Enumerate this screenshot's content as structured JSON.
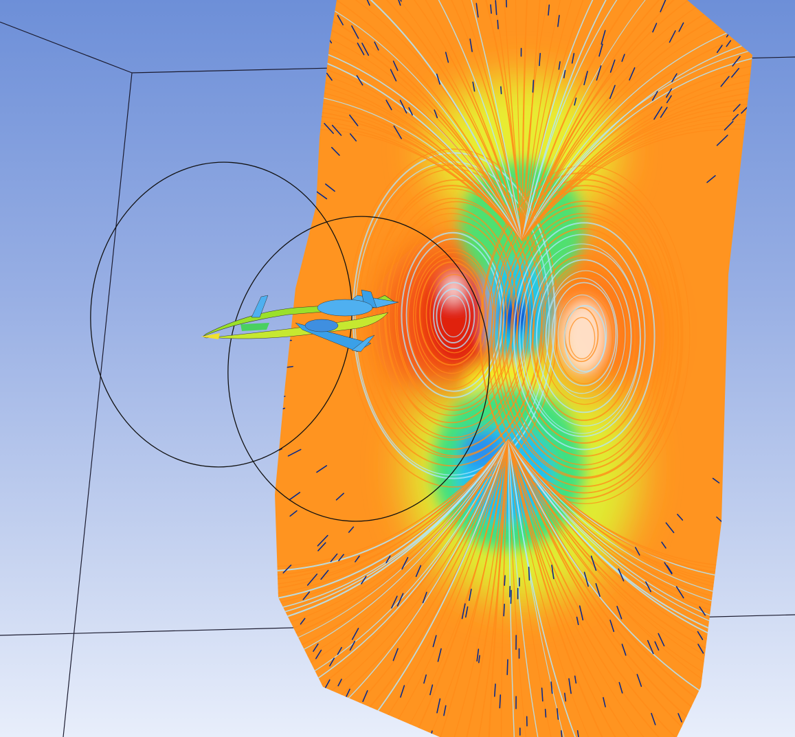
{
  "viewport": {
    "kind": "3d-cfd-visualization",
    "background_top": "#6d8fd8",
    "background_bottom": "#e8eefb"
  },
  "scene": {
    "domain_box": {
      "edge_color": "#1a1a2e"
    },
    "circles": {
      "count": 2,
      "edge_color": "#111111"
    },
    "aircraft": {
      "name": "business-jet",
      "surface_colors": [
        "#8ee02a",
        "#4fb0f0",
        "#f0e030"
      ]
    },
    "plane_contour": {
      "colormap": [
        "#1030d0",
        "#20c0f0",
        "#40e080",
        "#f0f020",
        "#ff8a10",
        "#e02010"
      ],
      "streamline_color": "#ff8c1a",
      "streamline_highlight": "#b0e6ff",
      "vector_color": "#0a2a8a"
    }
  }
}
